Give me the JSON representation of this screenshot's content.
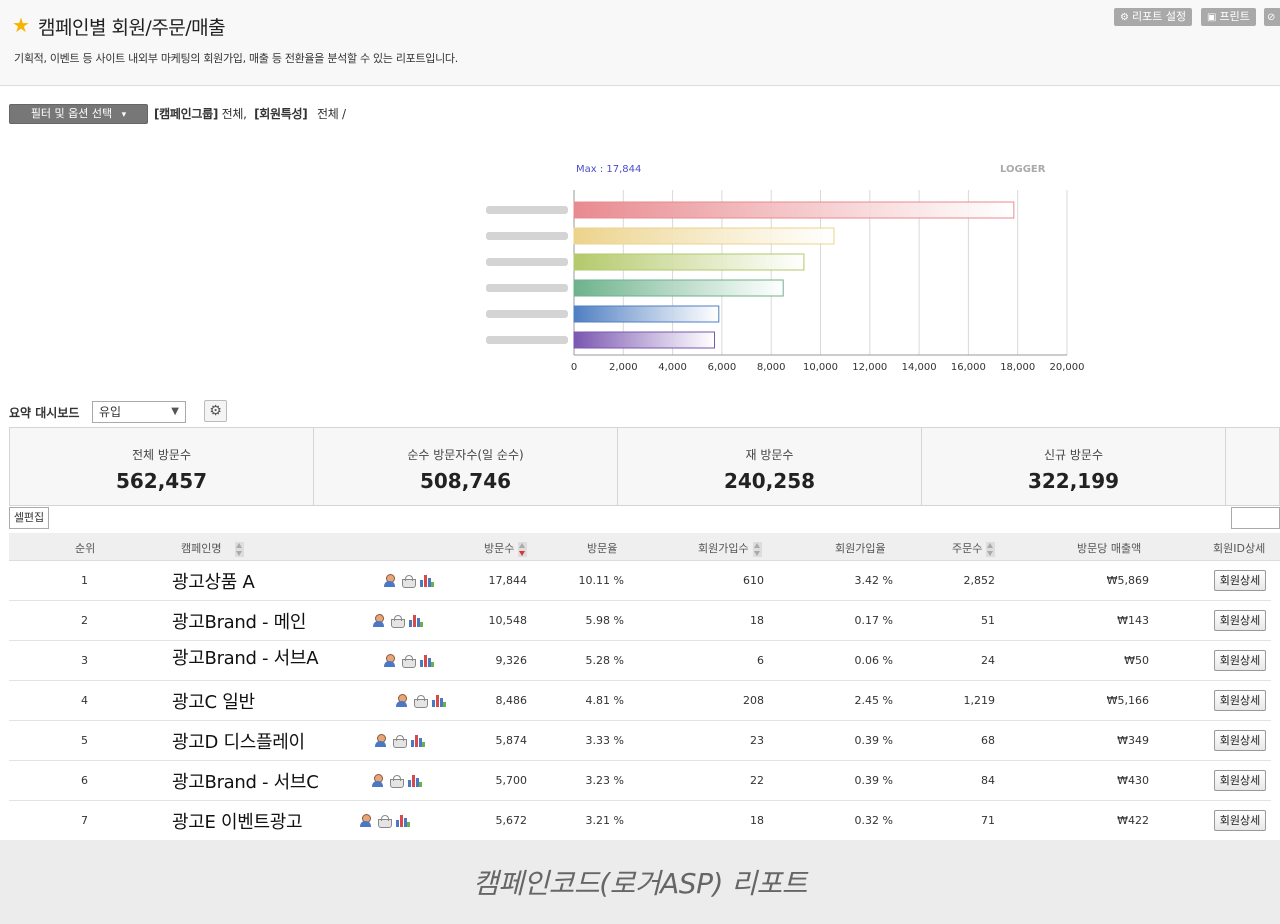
{
  "header": {
    "title": "캠페인별 회원/주문/매출",
    "description": "기획적, 이벤트 등 사이트 내외부 마케팅의 회원가입, 매출 등 전환율을 분석할 수 있는 리포트입니다.",
    "report_settings_label": "리포트 설정",
    "print_label": "프린트",
    "star_icon": "star-icon"
  },
  "filter": {
    "button_label": "필터 및 옵션 선택",
    "group_label": "[캠페인그룹]",
    "group_value": "전체,",
    "member_label": "[회원특성]",
    "member_value": "전체 /"
  },
  "chart_data": {
    "type": "bar",
    "orientation": "horizontal",
    "max_label": "Max : 17,844",
    "watermark": "LOGGER",
    "categories": [
      "",
      "",
      "",
      "",
      "",
      ""
    ],
    "values": [
      17844,
      10548,
      9326,
      8486,
      5874,
      5700
    ],
    "xlim": [
      0,
      20000
    ],
    "xticks": [
      "0",
      "2,000",
      "4,000",
      "6,000",
      "8,000",
      "10,000",
      "12,000",
      "14,000",
      "16,000",
      "18,000",
      "20,000"
    ],
    "grid": true,
    "colors": [
      "#e88a8f",
      "#ecd38c",
      "#b3c96a",
      "#6db28c",
      "#4f7fc2",
      "#7a56b0"
    ]
  },
  "dashboard": {
    "label": "요약 대시보드",
    "select_value": "유입",
    "stats": [
      {
        "label": "전체 방문수",
        "value": "562,457"
      },
      {
        "label": "순수 방문자수(일 순수)",
        "value": "508,746"
      },
      {
        "label": "재 방문수",
        "value": "240,258"
      },
      {
        "label": "신규 방문수",
        "value": "322,199"
      }
    ],
    "cell_edit_label": "셀편집"
  },
  "table": {
    "headers": {
      "rank": "순위",
      "name": "캠페인명",
      "visits": "방문수",
      "visit_rate": "방문율",
      "signups": "회원가입수",
      "signup_rate": "회원가입율",
      "orders": "주문수",
      "revenue_per_visit": "방문당 매출액",
      "member_detail": "회원ID상세"
    },
    "detail_button_label": "회원상세",
    "rows": [
      {
        "rank": "1",
        "name": "광고상품 A",
        "visits": "17,844",
        "visit_rate": "10.11 %",
        "signups": "610",
        "signup_rate": "3.42 %",
        "orders": "2,852",
        "rpv": "₩5,869"
      },
      {
        "rank": "2",
        "name": "광고Brand - 메인",
        "visits": "10,548",
        "visit_rate": "5.98 %",
        "signups": "18",
        "signup_rate": "0.17 %",
        "orders": "51",
        "rpv": "₩143"
      },
      {
        "rank": "3",
        "name": "광고Brand - 서브A",
        "visits": "9,326",
        "visit_rate": "5.28 %",
        "signups": "6",
        "signup_rate": "0.06 %",
        "orders": "24",
        "rpv": "₩50"
      },
      {
        "rank": "4",
        "name": "광고C 일반",
        "visits": "8,486",
        "visit_rate": "4.81 %",
        "signups": "208",
        "signup_rate": "2.45 %",
        "orders": "1,219",
        "rpv": "₩5,166"
      },
      {
        "rank": "5",
        "name": "광고D 디스플레이",
        "visits": "5,874",
        "visit_rate": "3.33 %",
        "signups": "23",
        "signup_rate": "0.39 %",
        "orders": "68",
        "rpv": "₩349"
      },
      {
        "rank": "6",
        "name": "광고Brand - 서브C",
        "visits": "5,700",
        "visit_rate": "3.23 %",
        "signups": "22",
        "signup_rate": "0.39 %",
        "orders": "84",
        "rpv": "₩430"
      },
      {
        "rank": "7",
        "name": "광고E 이벤트광고",
        "visits": "5,672",
        "visit_rate": "3.21 %",
        "signups": "18",
        "signup_rate": "0.32 %",
        "orders": "71",
        "rpv": "₩422"
      }
    ]
  },
  "footer": {
    "caption": "캠페인코드(로거ASP) 리포트"
  }
}
